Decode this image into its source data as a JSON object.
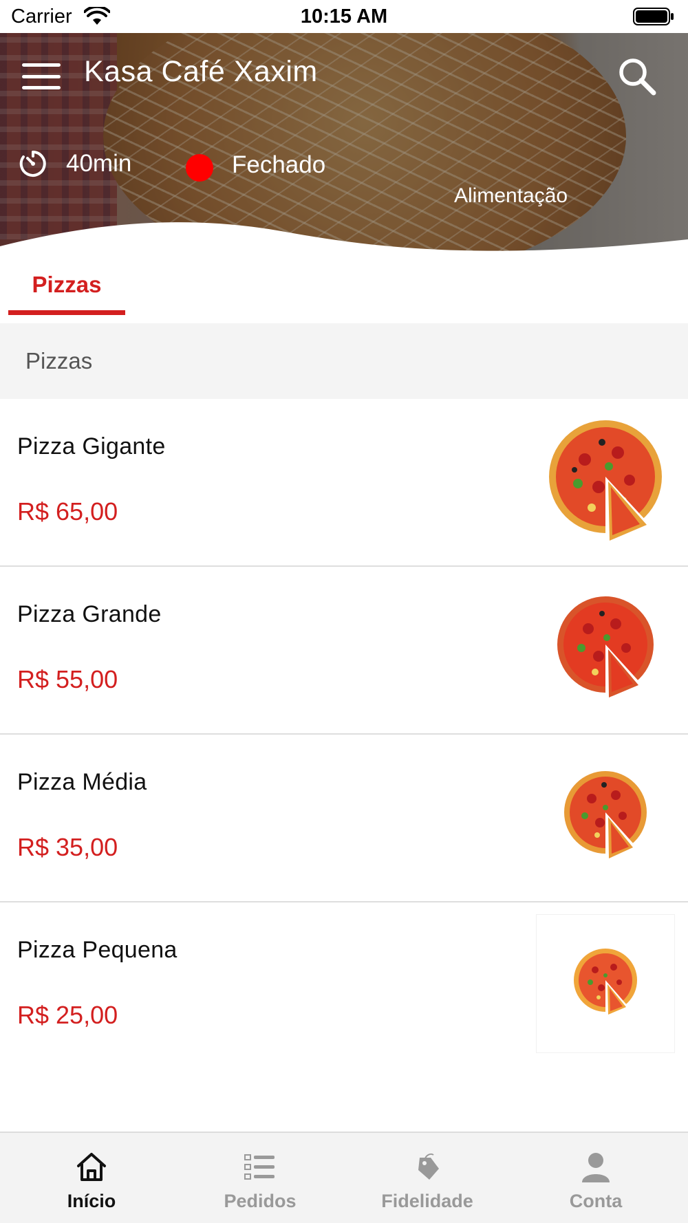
{
  "status_bar": {
    "carrier": "Carrier",
    "time": "10:15 AM"
  },
  "header": {
    "store_name": "Kasa Café Xaxim",
    "delivery_time": "40min",
    "open_status": "Fechado",
    "status_color": "#ff0000",
    "category": "Alimentação",
    "menu_icon": "menu-icon",
    "search_icon": "search-icon",
    "timer_icon": "timer-icon"
  },
  "tabs": [
    {
      "label": "Pizzas",
      "active": true
    }
  ],
  "section": {
    "title": "Pizzas"
  },
  "products": [
    {
      "name": "Pizza Gigante",
      "price": "R$ 65,00"
    },
    {
      "name": "Pizza Grande",
      "price": "R$ 55,00"
    },
    {
      "name": "Pizza Média",
      "price": "R$ 35,00"
    },
    {
      "name": "Pizza Pequena",
      "price": "R$ 25,00"
    }
  ],
  "bottom_nav": [
    {
      "label": "Início",
      "icon": "home-icon",
      "active": true
    },
    {
      "label": "Pedidos",
      "icon": "orders-list-icon",
      "active": false
    },
    {
      "label": "Fidelidade",
      "icon": "loyalty-tag-icon",
      "active": false
    },
    {
      "label": "Conta",
      "icon": "account-icon",
      "active": false
    }
  ],
  "colors": {
    "accent": "#d31f1f",
    "nav_inactive": "#999999",
    "nav_active": "#111111"
  }
}
